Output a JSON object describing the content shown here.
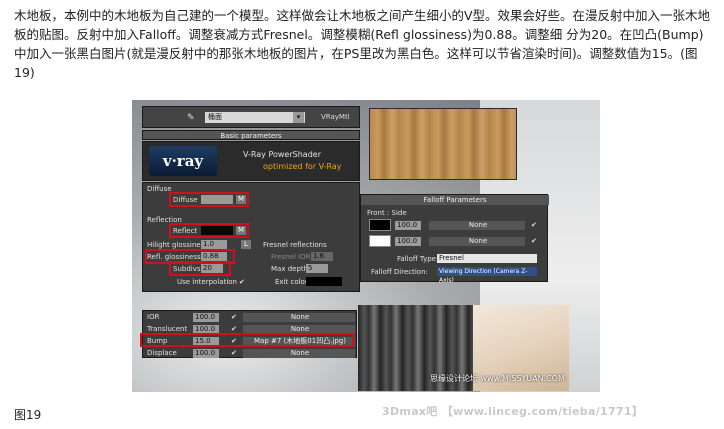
{
  "article": {
    "paragraph": "木地板，本例中的木地板为自己建的一个模型。这样做会让木地板之间产生细小的V型。效果会好些。在漫反射中加入一张木地板的贴图。反射中加入Falloff。调整衰减方式Fresnel。调整模糊(Refl glossiness)为0.88。调整细 分为20。在凹凸(Bump)中加入一张黑白图片(就是漫反射中的那张木地板的图片，在PS里改为黑白色。这样可以节省渲染时间)。调整数值为15。(图19)"
  },
  "figure": {
    "material_editor": {
      "material_name": "桶面",
      "material_type": "VRayMtl",
      "rollout_title": "Basic parameters",
      "vray_logo": "v·ray",
      "shader_title": "V-Ray PowerShader",
      "shader_subtitle": "optimized for V-Ray",
      "diffuse_group": "Diffuse",
      "diffuse_label": "Diffuse",
      "map_button": "M",
      "reflection_group": "Reflection",
      "reflect_label": "Reflect",
      "hilight_glossiness_label": "Hilight glossiness",
      "hilight_glossiness_value": "1.0",
      "lock_button": "L",
      "fresnel_reflections_label": "Fresnel reflections",
      "refl_glossiness_label": "Refl. glossiness",
      "refl_glossiness_value": "0.88",
      "fresnel_ior_label": "Fresnel IOR",
      "fresnel_ior_value": "1.6",
      "subdivs_label": "Subdivs",
      "subdivs_value": "20",
      "max_depth_label": "Max depth",
      "max_depth_value": "5",
      "use_interpolation_label": "Use interpolation",
      "exit_color_label": "Exit color"
    },
    "maps_rollout": [
      {
        "name": "IOR",
        "value": "100.0",
        "map": "None"
      },
      {
        "name": "Translucent",
        "value": "100.0",
        "map": "None"
      },
      {
        "name": "Bump",
        "value": "15.0",
        "map": "Map #7 (木地板01凹凸.jpg)"
      },
      {
        "name": "Displace",
        "value": "100.0",
        "map": "None"
      }
    ],
    "falloff": {
      "title": "Falloff Parameters",
      "front_side_label": "Front : Side",
      "slots": [
        {
          "value": "100.0",
          "map": "None"
        },
        {
          "value": "100.0",
          "map": "None"
        }
      ],
      "falloff_type_label": "Falloff Type:",
      "falloff_type_value": "Fresnel",
      "falloff_direction_label": "Falloff Direction:",
      "falloff_direction_value": "Viewing Direction (Camera Z-Axis)"
    },
    "watermark": "思缘设计论坛  www.MISSYUAN.COM"
  },
  "caption": "图19",
  "site_watermark": "3Dmax吧 【www.linceg.com/tieba/1771】",
  "colors": {
    "highlight_box": "#d0111b",
    "panel_bg": "#3c3c3c",
    "shader_subtitle": "#f0a020"
  }
}
